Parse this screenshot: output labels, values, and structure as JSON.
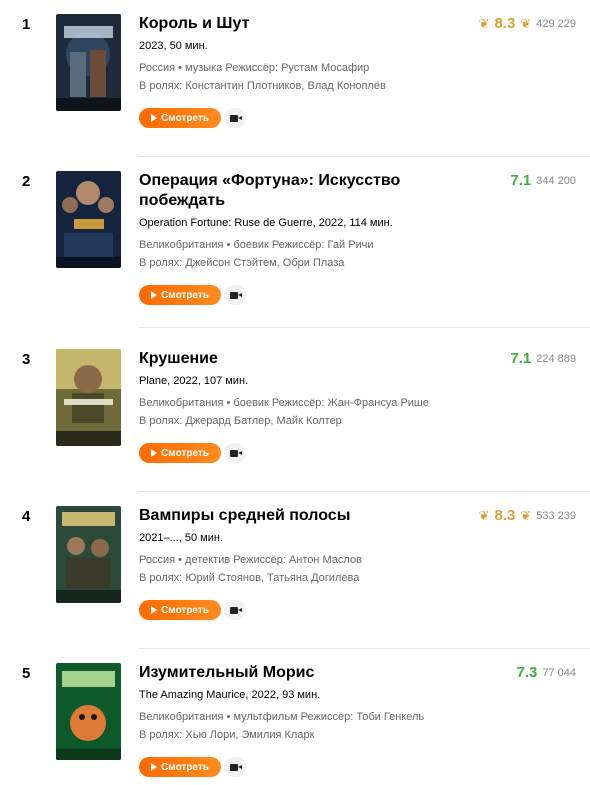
{
  "items": [
    {
      "rank": "1",
      "title": "Король и Шут",
      "subtitle": "2023, 50 мин.",
      "meta": "Россия • музыка  Режиссёр: Рустам Мосафир",
      "cast": "В ролях: Константин Плотников, Влад Коноплёв",
      "rating": "8.3",
      "votes": "429 229",
      "top": true
    },
    {
      "rank": "2",
      "title": "Операция «Фортуна»: Искусство побеждать",
      "subtitle": "Operation Fortune: Ruse de Guerre, 2022, 114 мин.",
      "meta": "Великобритания • боевик  Режиссёр: Гай Ричи",
      "cast": "В ролях: Джейсон Стэйтем, Обри Плаза",
      "rating": "7.1",
      "votes": "344 200",
      "top": false
    },
    {
      "rank": "3",
      "title": "Крушение",
      "subtitle": "Plane, 2022, 107 мин.",
      "meta": "Великобритания • боевик  Режиссёр: Жан-Франсуа Рише",
      "cast": "В ролях: Джерард Батлер, Майк Колтер",
      "rating": "7.1",
      "votes": "224 889",
      "top": false
    },
    {
      "rank": "4",
      "title": "Вампиры средней полосы",
      "subtitle": "2021–..., 50 мин.",
      "meta": "Россия • детектив  Режиссёр: Антон Маслов",
      "cast": "В ролях: Юрий Стоянов, Татьяна Догилева",
      "rating": "8.3",
      "votes": "533 239",
      "top": true
    },
    {
      "rank": "5",
      "title": "Изумительный Морис",
      "subtitle": "The Amazing Maurice, 2022, 93 мин.",
      "meta": "Великобритания • мультфильм  Режиссёр: Тоби Генкель",
      "cast": "В ролях: Хью Лори, Эмилия Кларк",
      "rating": "7.3",
      "votes": "77 044",
      "top": false
    }
  ],
  "watch_label": "Смотреть",
  "icons": {
    "play": "play-icon",
    "trailer": "video-camera-icon",
    "laurel": "laurel-icon"
  },
  "colors": {
    "accent": "#ff6a00",
    "rating_green": "#3bb33b",
    "rating_top": "#d4a63a"
  }
}
